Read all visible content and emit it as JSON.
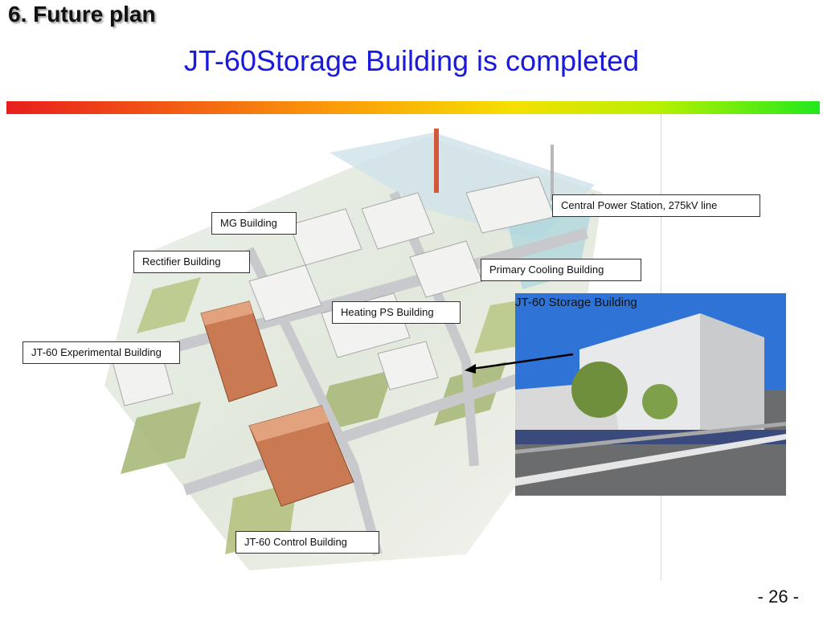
{
  "slide": {
    "section_title": "6. Future plan",
    "title": "JT-60Storage Building is completed",
    "page_number": "- 26 -"
  },
  "labels": {
    "central_power": "Central Power Station, 275kV line",
    "mg_building": "MG Building",
    "rectifier": "Rectifier Building",
    "primary_cooling": "Primary Cooling Building",
    "heating_ps": "Heating PS Building",
    "experimental": "JT-60 Experimental Building",
    "control": "JT-60 Control Building"
  },
  "photo": {
    "caption": "JT-60 Storage Building"
  }
}
